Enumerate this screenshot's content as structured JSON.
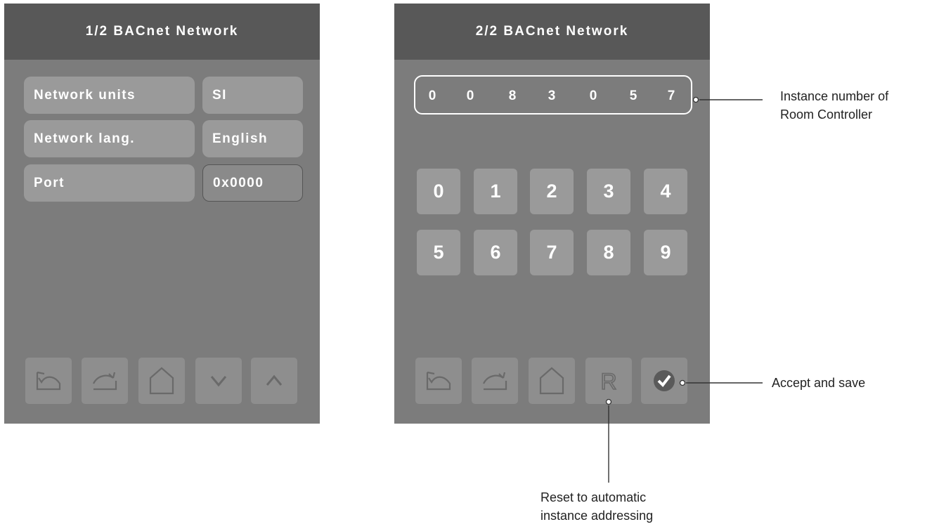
{
  "screen1": {
    "title": "1/2 BACnet Network",
    "rows": [
      {
        "label": "Network units",
        "value": "SI"
      },
      {
        "label": "Network lang.",
        "value": "English"
      },
      {
        "label": "Port",
        "value": "0x0000"
      }
    ],
    "nav_icons": [
      "undo-icon",
      "redo-icon",
      "home-icon",
      "chevron-down-icon",
      "chevron-up-icon"
    ]
  },
  "screen2": {
    "title": "2/2 BACnet Network",
    "instance_digits": [
      "0",
      "0",
      "8",
      "3",
      "0",
      "5",
      "7"
    ],
    "keypad": [
      "0",
      "1",
      "2",
      "3",
      "4",
      "5",
      "6",
      "7",
      "8",
      "9"
    ],
    "nav_icons": [
      "undo-icon",
      "redo-icon",
      "home-icon",
      "reset-icon",
      "check-icon"
    ],
    "reset_label": "R"
  },
  "callouts": {
    "instance_number": [
      "Instance number of",
      "Room Controller"
    ],
    "accept_save": "Accept and save",
    "reset": [
      "Reset to automatic",
      "instance addressing"
    ]
  },
  "colors": {
    "screen_bg": "#7c7c7c",
    "header_bg": "#585858",
    "pill_bg": "#9a9a9a",
    "icon": "#6a6a6a"
  }
}
